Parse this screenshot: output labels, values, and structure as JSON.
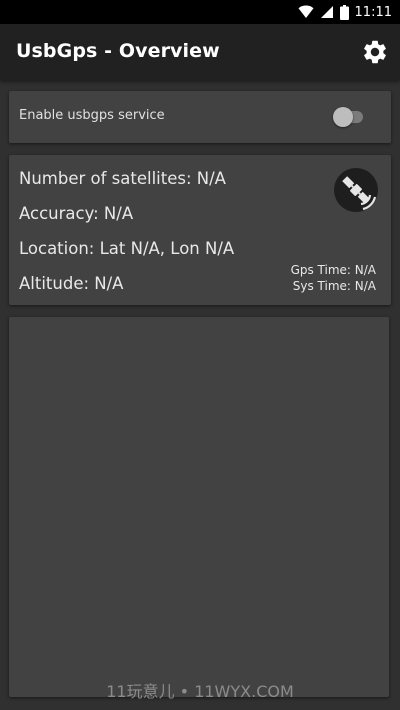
{
  "status_bar": {
    "time": "11:11",
    "icons": [
      "wifi-icon",
      "cellular-signal-icon",
      "battery-icon"
    ]
  },
  "app_bar": {
    "title": "UsbGps - Overview",
    "settings_icon": "gear-icon"
  },
  "service_card": {
    "label": "Enable usbgps service",
    "enabled": false
  },
  "gps_info": {
    "satellites": "Number of satellites: N/A",
    "accuracy": "Accuracy: N/A",
    "location": "Location: Lat N/A, Lon N/A",
    "altitude": "Altitude: N/A",
    "gps_time": "Gps Time: N/A",
    "sys_time": "Sys Time: N/A",
    "status_icon": "satellite-icon"
  },
  "log_panel": {
    "lines": []
  },
  "watermark": "11玩意儿 • 11WYX.COM",
  "colors": {
    "background": "#303030",
    "app_bar": "#212121",
    "card": "#424242",
    "text": "#e8e8e8"
  }
}
